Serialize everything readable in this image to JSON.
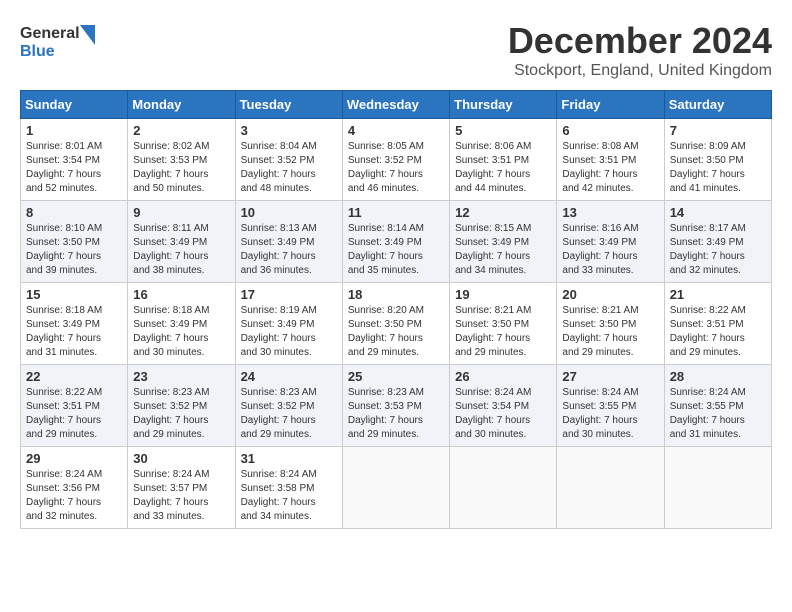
{
  "logo": {
    "line1": "General",
    "line2": "Blue"
  },
  "title": "December 2024",
  "subtitle": "Stockport, England, United Kingdom",
  "days_of_week": [
    "Sunday",
    "Monday",
    "Tuesday",
    "Wednesday",
    "Thursday",
    "Friday",
    "Saturday"
  ],
  "weeks": [
    [
      {
        "day": "1",
        "sunrise": "8:01 AM",
        "sunset": "3:54 PM",
        "daylight": "7 hours and 52 minutes."
      },
      {
        "day": "2",
        "sunrise": "8:02 AM",
        "sunset": "3:53 PM",
        "daylight": "7 hours and 50 minutes."
      },
      {
        "day": "3",
        "sunrise": "8:04 AM",
        "sunset": "3:52 PM",
        "daylight": "7 hours and 48 minutes."
      },
      {
        "day": "4",
        "sunrise": "8:05 AM",
        "sunset": "3:52 PM",
        "daylight": "7 hours and 46 minutes."
      },
      {
        "day": "5",
        "sunrise": "8:06 AM",
        "sunset": "3:51 PM",
        "daylight": "7 hours and 44 minutes."
      },
      {
        "day": "6",
        "sunrise": "8:08 AM",
        "sunset": "3:51 PM",
        "daylight": "7 hours and 42 minutes."
      },
      {
        "day": "7",
        "sunrise": "8:09 AM",
        "sunset": "3:50 PM",
        "daylight": "7 hours and 41 minutes."
      }
    ],
    [
      {
        "day": "8",
        "sunrise": "8:10 AM",
        "sunset": "3:50 PM",
        "daylight": "7 hours and 39 minutes."
      },
      {
        "day": "9",
        "sunrise": "8:11 AM",
        "sunset": "3:49 PM",
        "daylight": "7 hours and 38 minutes."
      },
      {
        "day": "10",
        "sunrise": "8:13 AM",
        "sunset": "3:49 PM",
        "daylight": "7 hours and 36 minutes."
      },
      {
        "day": "11",
        "sunrise": "8:14 AM",
        "sunset": "3:49 PM",
        "daylight": "7 hours and 35 minutes."
      },
      {
        "day": "12",
        "sunrise": "8:15 AM",
        "sunset": "3:49 PM",
        "daylight": "7 hours and 34 minutes."
      },
      {
        "day": "13",
        "sunrise": "8:16 AM",
        "sunset": "3:49 PM",
        "daylight": "7 hours and 33 minutes."
      },
      {
        "day": "14",
        "sunrise": "8:17 AM",
        "sunset": "3:49 PM",
        "daylight": "7 hours and 32 minutes."
      }
    ],
    [
      {
        "day": "15",
        "sunrise": "8:18 AM",
        "sunset": "3:49 PM",
        "daylight": "7 hours and 31 minutes."
      },
      {
        "day": "16",
        "sunrise": "8:18 AM",
        "sunset": "3:49 PM",
        "daylight": "7 hours and 30 minutes."
      },
      {
        "day": "17",
        "sunrise": "8:19 AM",
        "sunset": "3:49 PM",
        "daylight": "7 hours and 30 minutes."
      },
      {
        "day": "18",
        "sunrise": "8:20 AM",
        "sunset": "3:50 PM",
        "daylight": "7 hours and 29 minutes."
      },
      {
        "day": "19",
        "sunrise": "8:21 AM",
        "sunset": "3:50 PM",
        "daylight": "7 hours and 29 minutes."
      },
      {
        "day": "20",
        "sunrise": "8:21 AM",
        "sunset": "3:50 PM",
        "daylight": "7 hours and 29 minutes."
      },
      {
        "day": "21",
        "sunrise": "8:22 AM",
        "sunset": "3:51 PM",
        "daylight": "7 hours and 29 minutes."
      }
    ],
    [
      {
        "day": "22",
        "sunrise": "8:22 AM",
        "sunset": "3:51 PM",
        "daylight": "7 hours and 29 minutes."
      },
      {
        "day": "23",
        "sunrise": "8:23 AM",
        "sunset": "3:52 PM",
        "daylight": "7 hours and 29 minutes."
      },
      {
        "day": "24",
        "sunrise": "8:23 AM",
        "sunset": "3:52 PM",
        "daylight": "7 hours and 29 minutes."
      },
      {
        "day": "25",
        "sunrise": "8:23 AM",
        "sunset": "3:53 PM",
        "daylight": "7 hours and 29 minutes."
      },
      {
        "day": "26",
        "sunrise": "8:24 AM",
        "sunset": "3:54 PM",
        "daylight": "7 hours and 30 minutes."
      },
      {
        "day": "27",
        "sunrise": "8:24 AM",
        "sunset": "3:55 PM",
        "daylight": "7 hours and 30 minutes."
      },
      {
        "day": "28",
        "sunrise": "8:24 AM",
        "sunset": "3:55 PM",
        "daylight": "7 hours and 31 minutes."
      }
    ],
    [
      {
        "day": "29",
        "sunrise": "8:24 AM",
        "sunset": "3:56 PM",
        "daylight": "7 hours and 32 minutes."
      },
      {
        "day": "30",
        "sunrise": "8:24 AM",
        "sunset": "3:57 PM",
        "daylight": "7 hours and 33 minutes."
      },
      {
        "day": "31",
        "sunrise": "8:24 AM",
        "sunset": "3:58 PM",
        "daylight": "7 hours and 34 minutes."
      },
      null,
      null,
      null,
      null
    ]
  ],
  "labels": {
    "sunrise": "Sunrise:",
    "sunset": "Sunset:",
    "daylight": "Daylight:"
  }
}
